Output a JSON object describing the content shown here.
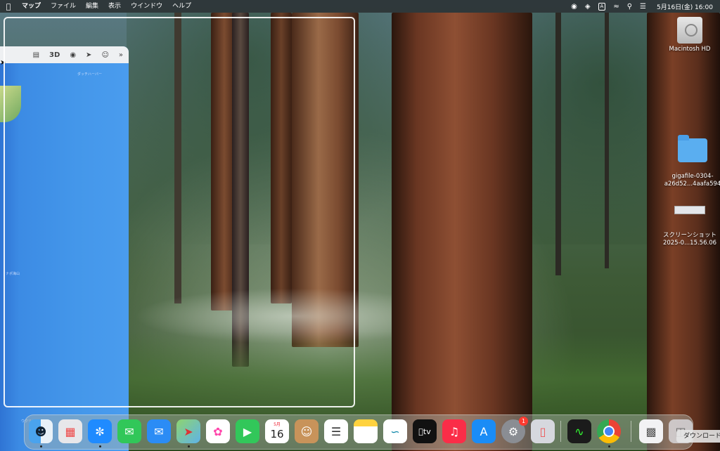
{
  "menubar": {
    "apple_icon": "apple-logo-icon",
    "items": [
      "マップ",
      "ファイル",
      "編集",
      "表示",
      "ウインドウ",
      "ヘルプ"
    ],
    "status_icons": [
      "record-icon",
      "layers-icon",
      "input-source-icon",
      "wifi-icon",
      "search-icon",
      "control-center-icon"
    ],
    "input_source": "A",
    "clock": "5月16日(金) 16:00"
  },
  "maps": {
    "toolbar": {
      "view_3d": "3D"
    },
    "labels": [
      "ダッチハーバー",
      "ナポ海山",
      "ウクリン"
    ]
  },
  "desktop": {
    "icons": [
      {
        "name": "Macintosh HD"
      },
      {
        "name": "gigafile-0304-\na26d52...4aafa594"
      },
      {
        "name": "スクリーンショット\n2025-0...15.56.06"
      }
    ]
  },
  "dock": {
    "calendar": {
      "month": "5月",
      "day": "16"
    },
    "settings_badge": "1",
    "tooltip": "ダウンロード"
  }
}
